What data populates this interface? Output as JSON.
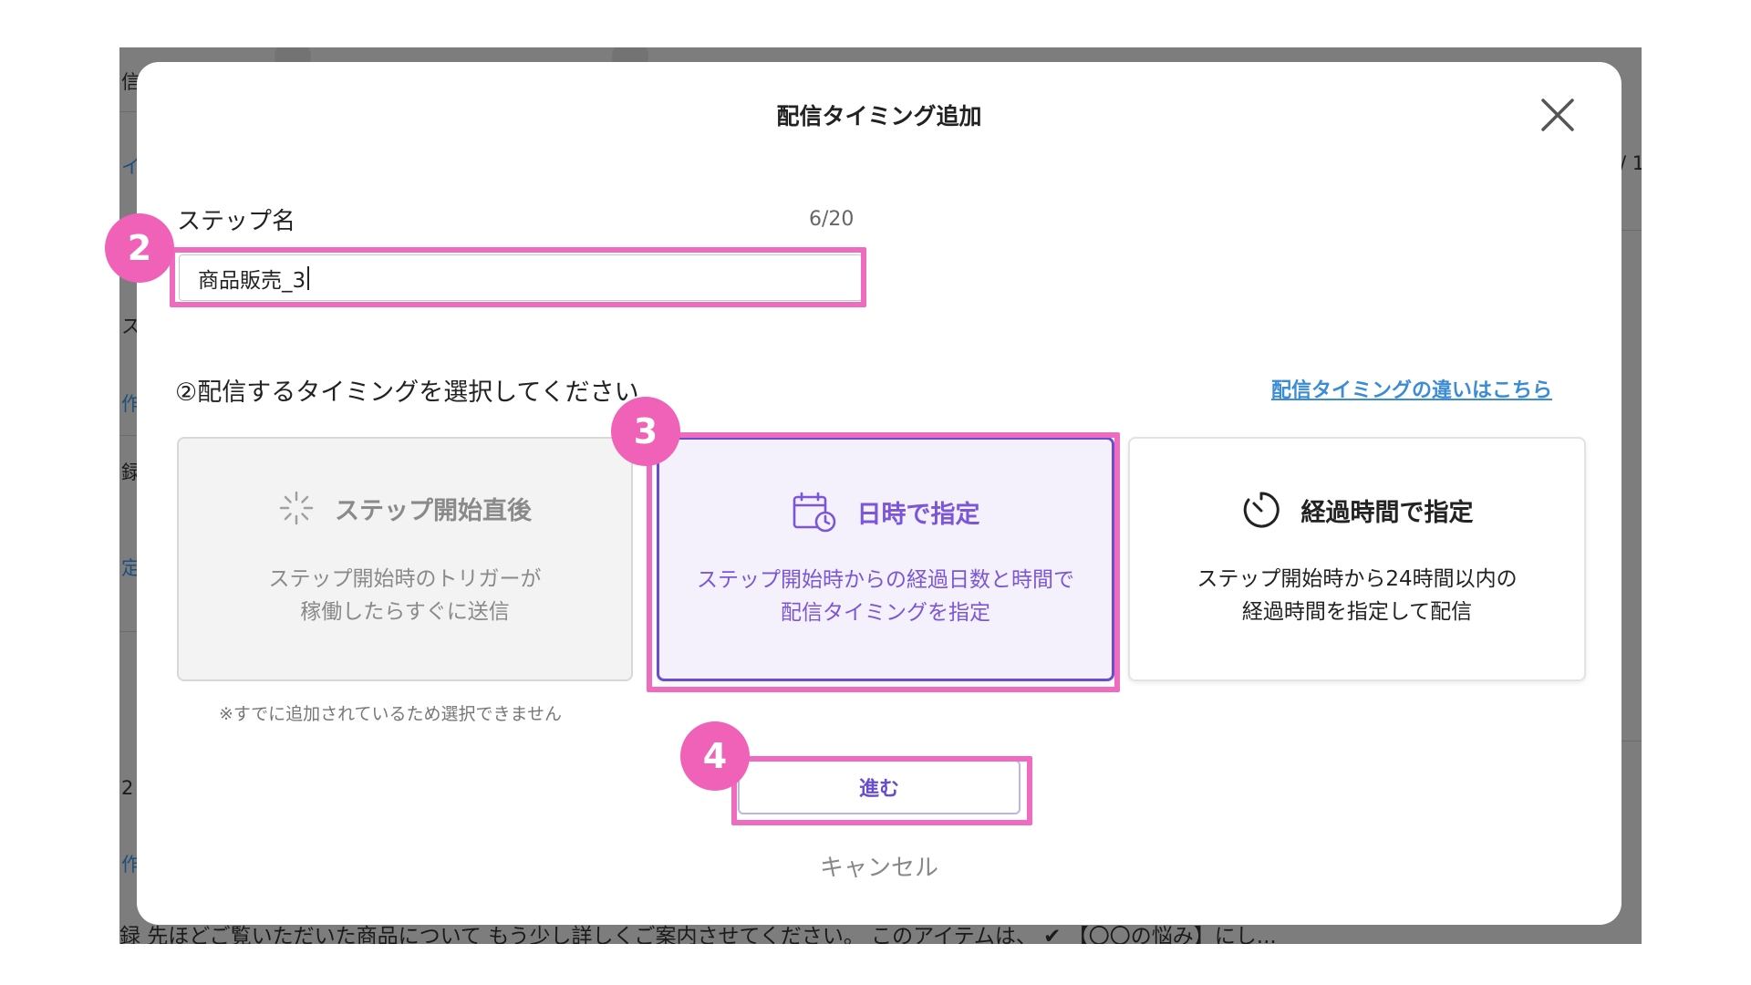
{
  "background": {
    "fragments": [
      "信",
      "イ",
      "ス",
      "作",
      "録",
      "定",
      "2",
      "作",
      "/ 1"
    ],
    "bottom_text": "録 先ほどご覧いただいた商品について もう少し詳しくご案内させてください。 このアイテムは、 ✔ 【〇〇の悩み】にし..."
  },
  "modal": {
    "title": "配信タイミング追加",
    "close_icon": "close-icon",
    "step_name": {
      "label": "ステップ名",
      "count": "6/20",
      "value": "商品販売_3"
    },
    "timing": {
      "prompt": "②配信するタイミングを選択してください",
      "help_link": "配信タイミングの違いはこちら",
      "options": [
        {
          "icon": "loading-spinner-icon",
          "title": "ステップ開始直後",
          "desc_line1": "ステップ開始時のトリガーが",
          "desc_line2": "稼働したらすぐに送信",
          "state": "disabled"
        },
        {
          "icon": "calendar-clock-icon",
          "title": "日時で指定",
          "desc_line1": "ステップ開始時からの経過日数と時間で",
          "desc_line2": "配信タイミングを指定",
          "state": "selected"
        },
        {
          "icon": "timer-icon",
          "title": "経過時間で指定",
          "desc_line1": "ステップ開始時から24時間以内の",
          "desc_line2": "経過時間を指定して配信",
          "state": "normal"
        }
      ],
      "disabled_note": "※すでに追加されているため選択できません"
    },
    "next_label": "進む",
    "cancel_label": "キャンセル"
  },
  "annotations": [
    "2",
    "3",
    "4"
  ],
  "colors": {
    "accent": "#6a4dcf",
    "highlight": "#ee6bbf",
    "badge": "#ef62b8",
    "link": "#3b8bd6"
  }
}
